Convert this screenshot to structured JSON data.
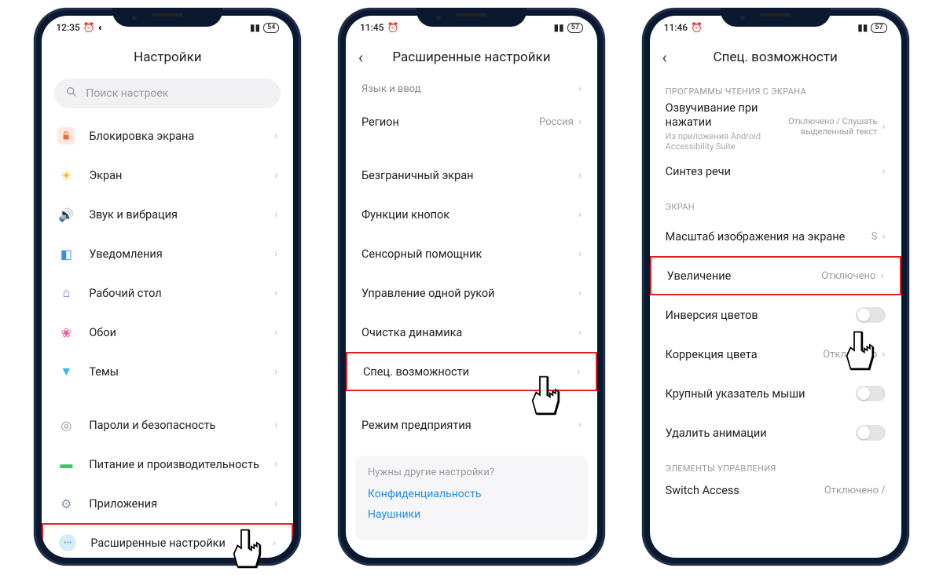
{
  "phone1": {
    "status": {
      "time": "12:35",
      "battery": "54"
    },
    "title": "Настройки",
    "search_placeholder": "Поиск настроек",
    "group1": [
      {
        "label": "Блокировка экрана"
      },
      {
        "label": "Экран"
      },
      {
        "label": "Звук и вибрация"
      },
      {
        "label": "Уведомления"
      },
      {
        "label": "Рабочий стол"
      },
      {
        "label": "Обои"
      },
      {
        "label": "Темы"
      }
    ],
    "group2": [
      {
        "label": "Пароли и безопасность"
      },
      {
        "label": "Питание и производительность"
      },
      {
        "label": "Приложения"
      },
      {
        "label": "Расширенные настройки"
      }
    ]
  },
  "phone2": {
    "status": {
      "time": "11:45",
      "battery": "57"
    },
    "title": "Расширенные настройки",
    "items_top": [
      {
        "label": "Язык и ввод"
      },
      {
        "label": "Регион",
        "value": "Россия"
      }
    ],
    "items_mid": [
      {
        "label": "Безграничный экран"
      },
      {
        "label": "Функции кнопок"
      },
      {
        "label": "Сенсорный помощник"
      },
      {
        "label": "Управление одной рукой"
      },
      {
        "label": "Очистка динамика"
      },
      {
        "label": "Спец. возможности"
      }
    ],
    "items_bot": [
      {
        "label": "Режим предприятия"
      }
    ],
    "footer": {
      "question": "Нужны другие настройки?",
      "link1": "Конфиденциальность",
      "link2": "Наушники"
    }
  },
  "phone3": {
    "status": {
      "time": "11:46",
      "battery": "57"
    },
    "title": "Спец. возможности",
    "section1": {
      "header": "ПРОГРАММЫ ЧТЕНИЯ С ЭКРАНА",
      "items": [
        {
          "label": "Озвучивание при нажатии",
          "sub": "Из приложения Android Accessibility Suite",
          "value": "Отключено / Слушать выделенный текст"
        },
        {
          "label": "Синтез речи"
        }
      ]
    },
    "section2": {
      "header": "ЭКРАН",
      "items": [
        {
          "label": "Масштаб изображения на экране",
          "value": "S"
        },
        {
          "label": "Увеличение",
          "value": "Отключено"
        },
        {
          "label": "Инверсия цветов"
        },
        {
          "label": "Коррекция цвета",
          "value": "Отключено"
        },
        {
          "label": "Крупный указатель мыши"
        },
        {
          "label": "Удалить анимации"
        }
      ]
    },
    "section3": {
      "header": "ЭЛЕМЕНТЫ УПРАВЛЕНИЯ",
      "items": [
        {
          "label": "Switch Access",
          "value": "Отключено /"
        }
      ]
    }
  }
}
